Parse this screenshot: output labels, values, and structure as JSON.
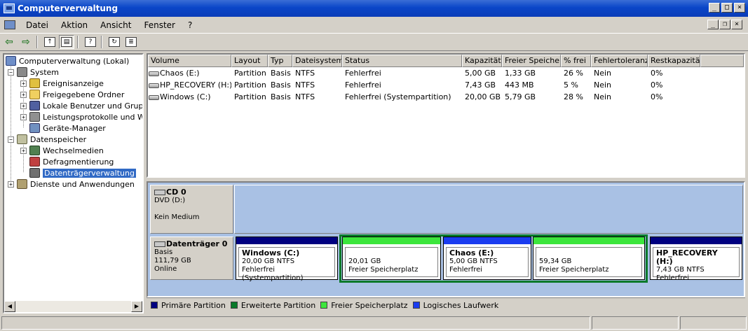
{
  "window": {
    "title": "Computerverwaltung"
  },
  "menu": [
    "Datei",
    "Aktion",
    "Ansicht",
    "Fenster",
    "?"
  ],
  "toolbar": [
    "back-icon",
    "forward-icon",
    "up-folder-icon",
    "show-tree-icon",
    "help-icon",
    "refresh-icon",
    "properties-icon"
  ],
  "tree": {
    "root": "Computerverwaltung (Lokal)",
    "items": [
      {
        "label": "System"
      },
      {
        "label": "Ereignisanzeige"
      },
      {
        "label": "Freigegebene Ordner"
      },
      {
        "label": "Lokale Benutzer und Gruppen"
      },
      {
        "label": "Leistungsprotokolle und Warnungen"
      },
      {
        "label": "Geräte-Manager"
      },
      {
        "label": "Datenspeicher"
      },
      {
        "label": "Wechselmedien"
      },
      {
        "label": "Defragmentierung"
      },
      {
        "label": "Datenträgerverwaltung"
      },
      {
        "label": "Dienste und Anwendungen"
      }
    ]
  },
  "volume_list": {
    "columns": [
      "Volume",
      "Layout",
      "Typ",
      "Dateisystem",
      "Status",
      "Kapazität",
      "Freier Speicher",
      "% frei",
      "Fehlertoleranz",
      "Restkapazität"
    ],
    "rows": [
      [
        "Chaos (E:)",
        "Partition",
        "Basis",
        "NTFS",
        "Fehlerfrei",
        "5,00 GB",
        "1,33 GB",
        "26 %",
        "Nein",
        "0%"
      ],
      [
        "HP_RECOVERY (H:)",
        "Partition",
        "Basis",
        "NTFS",
        "Fehlerfrei",
        "7,43 GB",
        "443 MB",
        "5 %",
        "Nein",
        "0%"
      ],
      [
        "Windows (C:)",
        "Partition",
        "Basis",
        "NTFS",
        "Fehlerfrei (Systempartition)",
        "20,00 GB",
        "5,79 GB",
        "28 %",
        "Nein",
        "0%"
      ]
    ]
  },
  "cd": {
    "name": "CD 0",
    "drive": "DVD (D:)",
    "status": "Kein Medium"
  },
  "disk0": {
    "name": "Datenträger 0",
    "type": "Basis",
    "size": "111,79 GB",
    "state": "Online",
    "partitions": [
      {
        "title": "Windows  (C:)",
        "line1": "20,00 GB NTFS",
        "line2": "Fehlerfrei (Systempartition)",
        "kind": "primary"
      },
      {
        "title": "",
        "line1": "20,01 GB",
        "line2": "Freier Speicherplatz",
        "kind": "free"
      },
      {
        "title": "Chaos  (E:)",
        "line1": "5,00 GB NTFS",
        "line2": "Fehlerfrei",
        "kind": "logical"
      },
      {
        "title": "",
        "line1": "59,34 GB",
        "line2": "Freier Speicherplatz",
        "kind": "free"
      },
      {
        "title": "HP_RECOVERY  (H:)",
        "line1": "7,43 GB NTFS",
        "line2": "Fehlerfrei",
        "kind": "primary"
      }
    ]
  },
  "legend": [
    {
      "label": "Primäre Partition",
      "color": "#000080"
    },
    {
      "label": "Erweiterte Partition",
      "color": "#0a7a2a"
    },
    {
      "label": "Freier Speicherplatz",
      "color": "#3ce63c"
    },
    {
      "label": "Logisches Laufwerk",
      "color": "#1a3cf0"
    }
  ],
  "colors": {
    "titlebar": "#0a46c8",
    "selection": "#316ac5",
    "disk_area": "#a9c1e4"
  }
}
